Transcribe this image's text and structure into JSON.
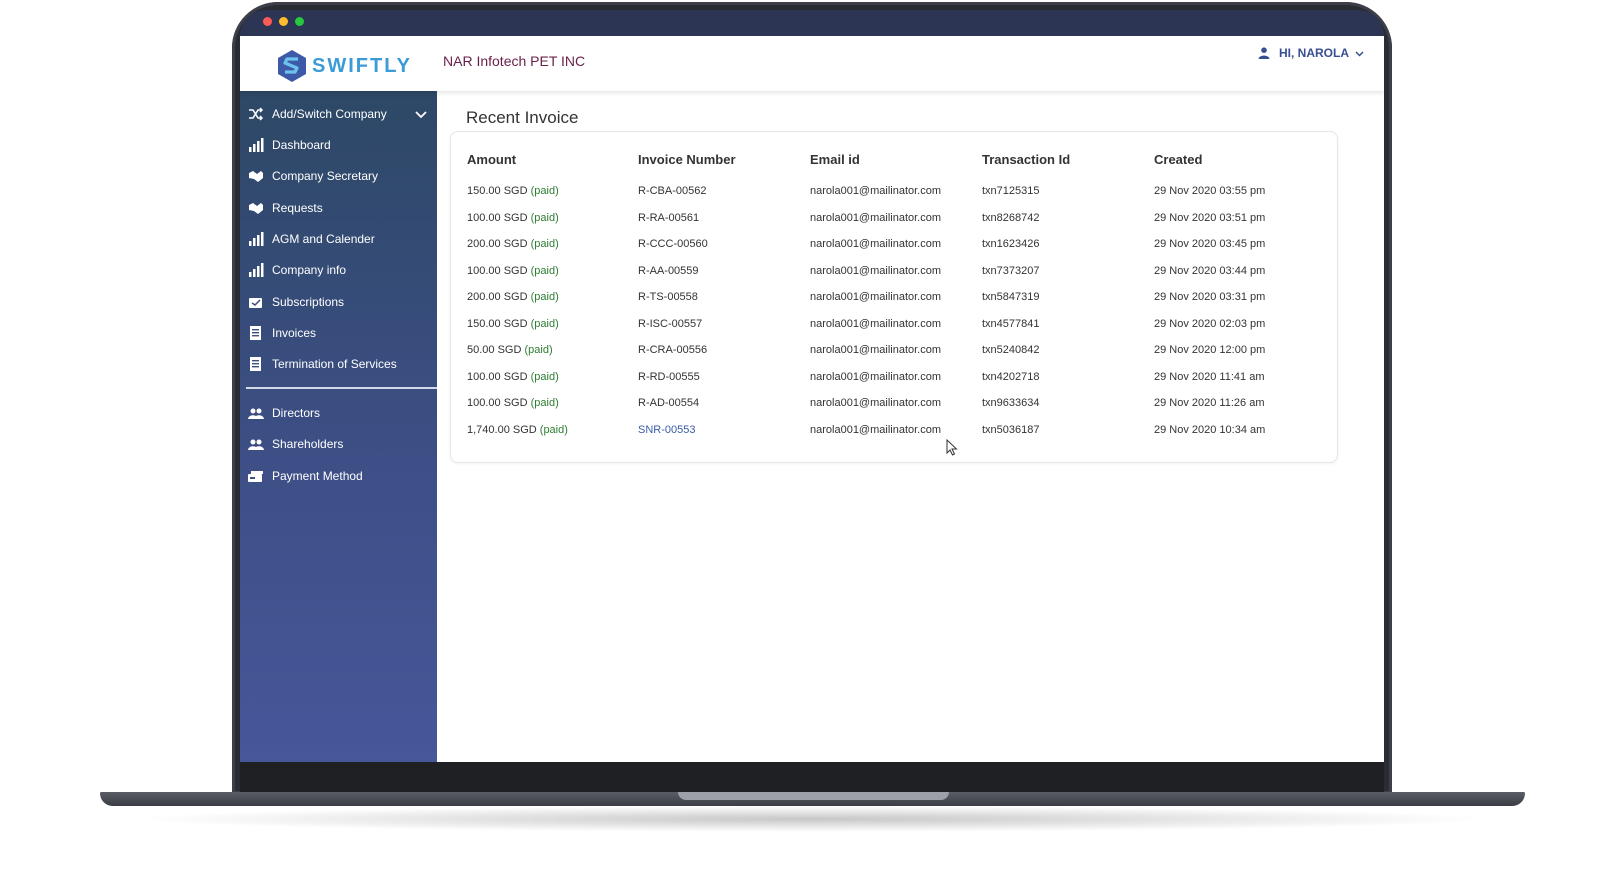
{
  "app": {
    "logo_text": "SWIFTLY",
    "company": "NAR Infotech PET INC",
    "user_greeting": "HI, NAROLA"
  },
  "sidebar": {
    "switch_label": "Add/Switch Company",
    "items": [
      {
        "label": "Dashboard",
        "icon": "bar-chart-icon"
      },
      {
        "label": "Company Secretary",
        "icon": "handshake-icon"
      },
      {
        "label": "Requests",
        "icon": "handshake-icon"
      },
      {
        "label": "AGM and Calender",
        "icon": "bar-chart-icon"
      },
      {
        "label": "Company info",
        "icon": "bar-chart-icon"
      },
      {
        "label": "Subscriptions",
        "icon": "subscription-icon"
      },
      {
        "label": "Invoices",
        "icon": "invoice-icon"
      },
      {
        "label": "Termination of Services",
        "icon": "invoice-icon"
      }
    ],
    "items2": [
      {
        "label": "Directors",
        "icon": "users-icon"
      },
      {
        "label": "Shareholders",
        "icon": "users-icon"
      },
      {
        "label": "Payment Method",
        "icon": "payment-icon"
      }
    ]
  },
  "main": {
    "title": "Recent Invoice",
    "columns": [
      "Amount",
      "Invoice Number",
      "Email id",
      "Transaction Id",
      "Created"
    ],
    "rows": [
      {
        "amount": "150.00 SGD",
        "status": "(paid)",
        "invoice": "R-CBA-00562",
        "email": "narola001@mailinator.com",
        "txn": "txn7125315",
        "created": "29 Nov 2020 03:55 pm"
      },
      {
        "amount": "100.00 SGD",
        "status": "(paid)",
        "invoice": "R-RA-00561",
        "email": "narola001@mailinator.com",
        "txn": "txn8268742",
        "created": "29 Nov 2020 03:51 pm"
      },
      {
        "amount": "200.00 SGD",
        "status": "(paid)",
        "invoice": "R-CCC-00560",
        "email": "narola001@mailinator.com",
        "txn": "txn1623426",
        "created": "29 Nov 2020 03:45 pm"
      },
      {
        "amount": "100.00 SGD",
        "status": "(paid)",
        "invoice": "R-AA-00559",
        "email": "narola001@mailinator.com",
        "txn": "txn7373207",
        "created": "29 Nov 2020 03:44 pm"
      },
      {
        "amount": "200.00 SGD",
        "status": "(paid)",
        "invoice": "R-TS-00558",
        "email": "narola001@mailinator.com",
        "txn": "txn5847319",
        "created": "29 Nov 2020 03:31 pm"
      },
      {
        "amount": "150.00 SGD",
        "status": "(paid)",
        "invoice": "R-ISC-00557",
        "email": "narola001@mailinator.com",
        "txn": "txn4577841",
        "created": "29 Nov 2020 02:03 pm"
      },
      {
        "amount": "50.00 SGD",
        "status": "(paid)",
        "invoice": "R-CRA-00556",
        "email": "narola001@mailinator.com",
        "txn": "txn5240842",
        "created": "29 Nov 2020 12:00 pm"
      },
      {
        "amount": "100.00 SGD",
        "status": "(paid)",
        "invoice": "R-RD-00555",
        "email": "narola001@mailinator.com",
        "txn": "txn4202718",
        "created": "29 Nov 2020 11:41 am"
      },
      {
        "amount": "100.00 SGD",
        "status": "(paid)",
        "invoice": "R-AD-00554",
        "email": "narola001@mailinator.com",
        "txn": "txn9633634",
        "created": "29 Nov 2020 11:26 am"
      },
      {
        "amount": "1,740.00 SGD",
        "status": "(paid)",
        "invoice": "SNR-00553",
        "email": "narola001@mailinator.com",
        "txn": "txn5036187",
        "created": "29 Nov 2020 10:34 am"
      }
    ]
  },
  "colors": {
    "brand": "#3a9bd6",
    "company_text": "#6a1f4a",
    "paid": "#2e7d32",
    "link": "#3a5ba8",
    "sidebar_top": "#2d4866",
    "sidebar_bottom": "#46579a"
  }
}
